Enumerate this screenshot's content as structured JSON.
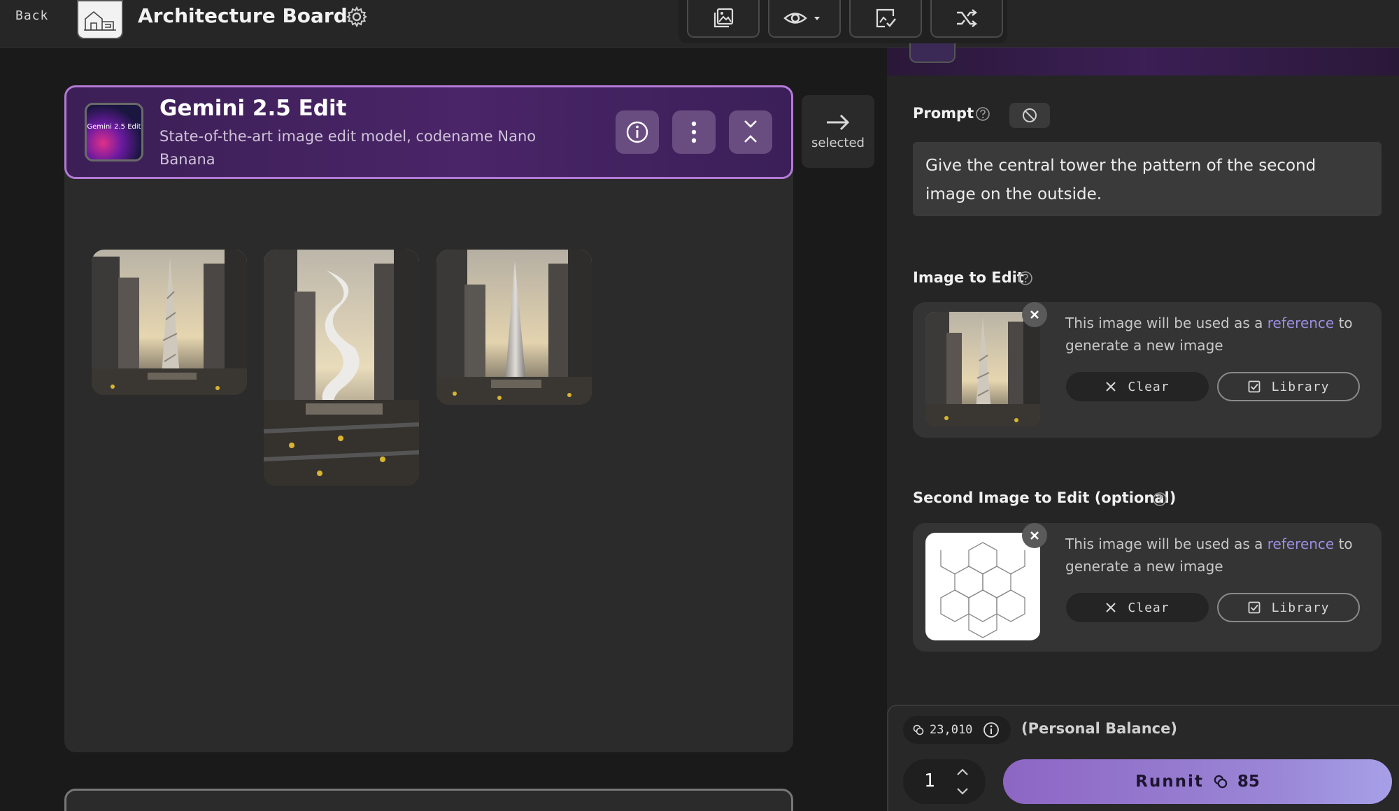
{
  "topbar": {
    "back_label": "Back",
    "board_title": "Architecture Board",
    "tools": [
      "gallery-icon",
      "eye-icon",
      "compare-icon",
      "shuffle-icon"
    ]
  },
  "model_card": {
    "name": "Gemini 2.5 Edit",
    "thumb_text": "Gemini 2.5 Edit",
    "description": "State-of-the-art image edit model, codename Nano Banana",
    "selected_label": "selected",
    "accent": "#b37ad6"
  },
  "prompt": {
    "label": "Prompt",
    "value": "Give the central tower the pattern of the second image on the outside."
  },
  "image_to_edit": {
    "label": "Image to Edit",
    "text_before": "This image will be used as a ",
    "link": "reference",
    "text_after": " to generate a new image",
    "clear_label": "Clear",
    "library_label": "Library"
  },
  "second_image": {
    "label": "Second Image to Edit (optional)",
    "text_before": "This image will be used as a ",
    "link": "reference",
    "text_after": " to generate a new image",
    "clear_label": "Clear",
    "library_label": "Library"
  },
  "run": {
    "balance": "23,010",
    "balance_label": "(Personal Balance)",
    "quantity": "1",
    "button_label": "Runnit",
    "cost": "85",
    "accent": "#9a86d6"
  }
}
